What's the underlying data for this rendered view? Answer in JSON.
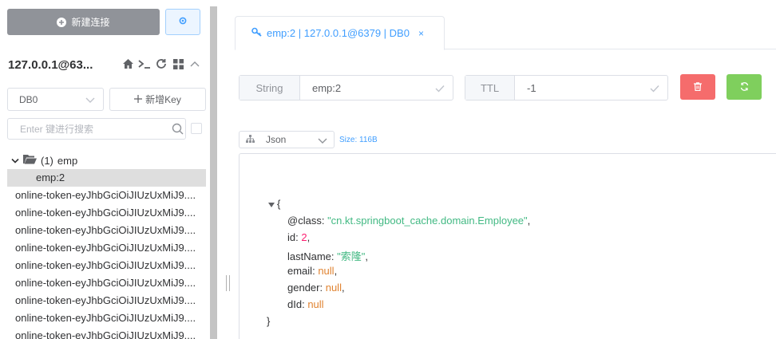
{
  "sidebar": {
    "new_connection_label": "新建连接",
    "connection_title": "127.0.0.1@63...",
    "db_select_value": "DB0",
    "new_key_label": "新增Key",
    "search_placeholder": "Enter 键进行搜索",
    "tree": {
      "folder_count": "(1)",
      "folder_name": "emp",
      "selected_key": "emp:2",
      "keys": [
        "online-token-eyJhbGciOiJIUzUxMiJ9....",
        "online-token-eyJhbGciOiJIUzUxMiJ9....",
        "online-token-eyJhbGciOiJIUzUxMiJ9....",
        "online-token-eyJhbGciOiJIUzUxMiJ9....",
        "online-token-eyJhbGciOiJIUzUxMiJ9....",
        "online-token-eyJhbGciOiJIUzUxMiJ9....",
        "online-token-eyJhbGciOiJIUzUxMiJ9....",
        "online-token-eyJhbGciOiJIUzUxMiJ9....",
        "online-token-eyJhbGciOiJIUzUxMiJ9...."
      ]
    }
  },
  "tab": {
    "label": "emp:2 | 127.0.0.1@6379 | DB0",
    "close": "×"
  },
  "key_info": {
    "type_label": "String",
    "key_name": "emp:2",
    "ttl_label": "TTL",
    "ttl_value": "-1"
  },
  "viewer": {
    "format": "Json",
    "size": "Size: 116B"
  },
  "json": {
    "open": "{",
    "close": "}",
    "class_key": "@class",
    "class_val": "\"cn.kt.springboot_cache.domain.Employee\"",
    "id_key": "id",
    "id_val": "2",
    "lastName_key": "lastName",
    "lastName_val": "\"索隆\"",
    "email_key": "email",
    "email_val": "null",
    "gender_key": "gender",
    "gender_val": "null",
    "dId_key": "dId",
    "dId_val": "null"
  },
  "colors": {
    "accent": "#409eff",
    "danger": "#f56c6c",
    "success": "#7fcf5d",
    "json_string": "#42b983",
    "json_number": "#fc1e70",
    "json_null": "#e08331"
  }
}
